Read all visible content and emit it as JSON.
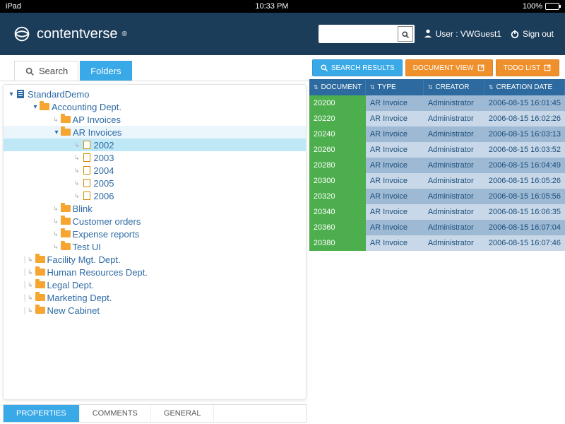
{
  "statusbar": {
    "device": "iPad",
    "time": "10:33 PM",
    "battery": "100%"
  },
  "header": {
    "brand": "contentverse",
    "user_label": "User : VWGuest1",
    "signout": "Sign out",
    "search_placeholder": ""
  },
  "left_tabs": {
    "search": "Search",
    "folders": "Folders"
  },
  "tree": {
    "root": "StandardDemo",
    "dept1": "Accounting Dept.",
    "ap": "AP Invoices",
    "ar": "AR Invoices",
    "y2002": "2002",
    "y2003": "2003",
    "y2004": "2004",
    "y2005": "2005",
    "y2006": "2006",
    "blink": "Blink",
    "cust": "Customer orders",
    "exp": "Expense reports",
    "testui": "Test UI",
    "fac": "Facility Mgt. Dept.",
    "hr": "Human Resources Dept.",
    "legal": "Legal Dept.",
    "mkt": "Marketing Dept.",
    "newcab": "New Cabinet"
  },
  "bottom_tabs": {
    "properties": "PROPERTIES",
    "comments": "COMMENTS",
    "general": "GENERAL"
  },
  "actions": {
    "search_results": "SEARCH RESULTS",
    "doc_view": "DOCUMENT VIEW",
    "todo": "TODO LIST"
  },
  "columns": {
    "document": "DOCUMENT",
    "type": "TYPE",
    "creator": "CREATOR",
    "creation_date": "CREATION DATE"
  },
  "rows": [
    {
      "doc": "20200",
      "type": "AR Invoice",
      "creator": "Administrator",
      "date": "2006-08-15 16:01:45"
    },
    {
      "doc": "20220",
      "type": "AR Invoice",
      "creator": "Administrator",
      "date": "2006-08-15 16:02:26"
    },
    {
      "doc": "20240",
      "type": "AR Invoice",
      "creator": "Administrator",
      "date": "2006-08-15 16:03:13"
    },
    {
      "doc": "20260",
      "type": "AR Invoice",
      "creator": "Administrator",
      "date": "2006-08-15 16:03:52"
    },
    {
      "doc": "20280",
      "type": "AR Invoice",
      "creator": "Administrator",
      "date": "2006-08-15 16:04:49"
    },
    {
      "doc": "20300",
      "type": "AR Invoice",
      "creator": "Administrator",
      "date": "2006-08-15 16:05:26"
    },
    {
      "doc": "20320",
      "type": "AR Invoice",
      "creator": "Administrator",
      "date": "2006-08-15 16:05:56"
    },
    {
      "doc": "20340",
      "type": "AR Invoice",
      "creator": "Administrator",
      "date": "2006-08-15 16:06:35"
    },
    {
      "doc": "20360",
      "type": "AR Invoice",
      "creator": "Administrator",
      "date": "2006-08-15 16:07:04"
    },
    {
      "doc": "20380",
      "type": "AR Invoice",
      "creator": "Administrator",
      "date": "2006-08-15 16:07:46"
    }
  ]
}
